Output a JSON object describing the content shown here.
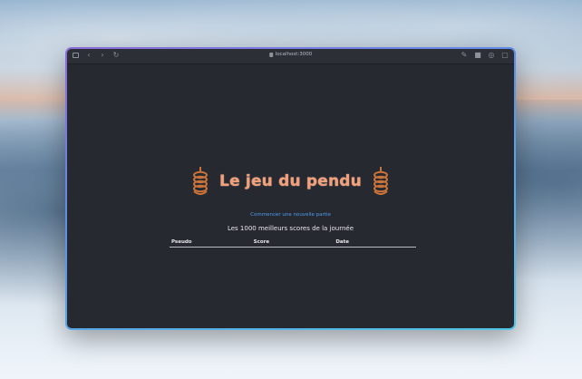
{
  "browser": {
    "url": "localhost:3000",
    "icons": [
      "sidebar-icon",
      "back-icon",
      "forward-icon",
      "reload-icon",
      "lock-icon",
      "pen-icon",
      "extension-icon",
      "share-icon",
      "tabs-icon"
    ]
  },
  "page": {
    "title": "Le jeu du pendu",
    "new_game_link": "Commencer une nouvelle partie",
    "scores_heading": "Les 1000 meilleurs scores de la journée",
    "table": {
      "columns": [
        "Pseudo",
        "Score",
        "Date"
      ],
      "rows": []
    }
  },
  "colors": {
    "title": "#f3a07a",
    "link": "#4f9cf0",
    "background": "#262930",
    "rope": "#c9733a"
  }
}
